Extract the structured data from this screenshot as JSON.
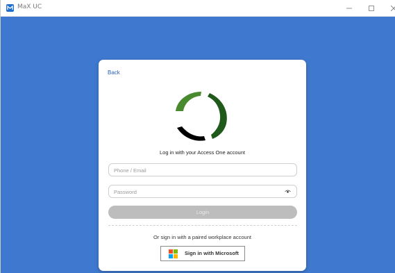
{
  "window": {
    "title": "MaX UC"
  },
  "login_card": {
    "back_label": "Back",
    "heading": "Log in with your Access One account",
    "phone_placeholder": "Phone / Email",
    "password_placeholder": "Password",
    "login_label": "Login",
    "alt_signin_text": "Or sign in with a paired workplace account",
    "microsoft_label": "Sign in with Microsoft"
  },
  "colors": {
    "background": "#3f79cf",
    "link": "#2c5fb8",
    "login_button_disabled": "#bdbdbd",
    "logo_green": "#3a7a2a",
    "logo_black": "#000000"
  },
  "icons": {
    "app": "max-uc-app-icon",
    "minimize": "minimize-icon",
    "maximize": "maximize-icon",
    "close": "close-icon",
    "password_toggle": "eye-icon",
    "microsoft": "microsoft-logo-icon"
  }
}
